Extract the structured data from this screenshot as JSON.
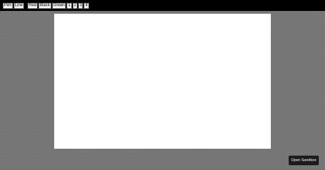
{
  "toolbar": {
    "tools": [
      "Pen",
      "Line"
    ],
    "colors": [
      "Red",
      "Black",
      "Green"
    ],
    "sizes": [
      "1",
      "2",
      "3",
      "4"
    ]
  },
  "canvas": {
    "background": "#ffffff"
  },
  "sandbox": {
    "label": "Open Sandbox"
  },
  "colors": {
    "toolbar_bg": "#000000",
    "page_bg": "#808080",
    "button_bg": "#1c1c1c"
  }
}
